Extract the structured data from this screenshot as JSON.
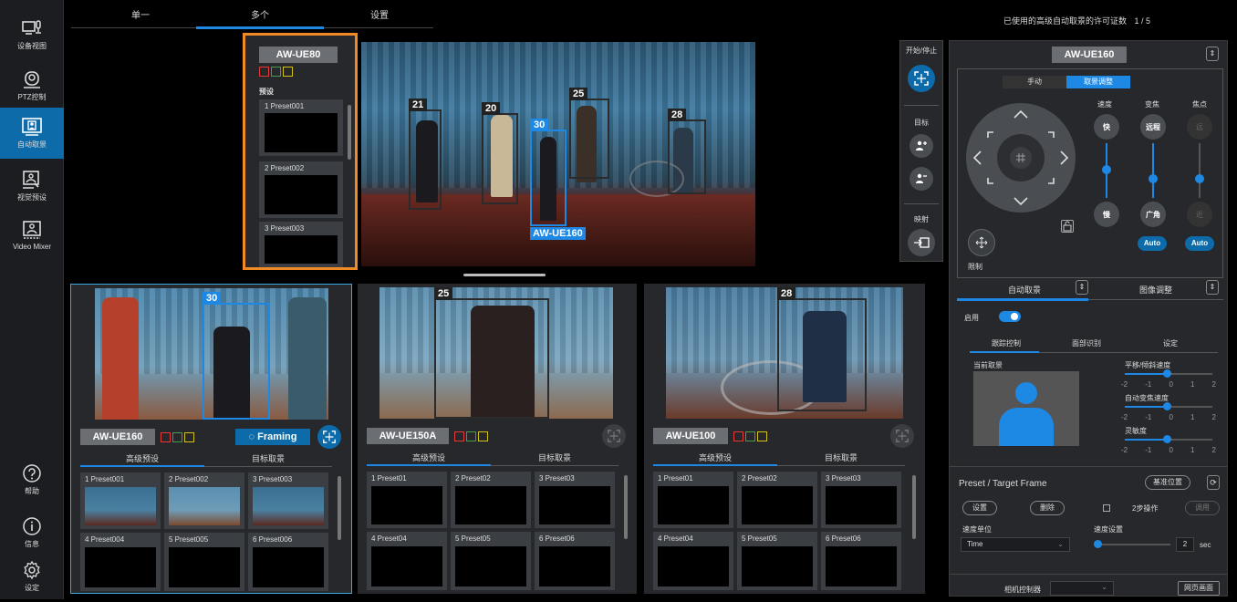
{
  "sidebar": {
    "items": [
      {
        "label": "设备视图",
        "icon": "device-view-icon"
      },
      {
        "label": "PTZ控制",
        "icon": "ptz-camera-icon"
      },
      {
        "label": "自动取景",
        "icon": "auto-framing-icon"
      },
      {
        "label": "视觉预设",
        "icon": "visual-preset-icon"
      },
      {
        "label": "Video Mixer",
        "icon": "video-mixer-icon"
      }
    ],
    "bottom": [
      {
        "label": "帮助",
        "icon": "help-icon"
      },
      {
        "label": "信息",
        "icon": "info-icon"
      },
      {
        "label": "设定",
        "icon": "settings-gear-icon"
      }
    ]
  },
  "tabs": [
    "单一",
    "多个",
    "设置"
  ],
  "license": {
    "label": "已使用的高级自动取景的许可证数",
    "value": "1 / 5"
  },
  "top_preset": {
    "camera": "AW-UE80",
    "section": "预设",
    "presets": [
      "1  Preset001",
      "2  Preset002",
      "3  Preset003"
    ]
  },
  "main_view": {
    "targets": [
      "21",
      "20",
      "30",
      "25",
      "28"
    ],
    "selected_caption": "AW-UE160"
  },
  "start_stop": {
    "label": "开始/停止",
    "target_label": "目标",
    "mapping_label": "映射"
  },
  "cameras": [
    {
      "name": "AW-UE160",
      "target": "30",
      "framing_label": "Framing",
      "tabs": [
        "高级预设",
        "目标取景"
      ],
      "presets": [
        "1  Preset001",
        "2  Preset002",
        "3  Preset003",
        "4  Preset004",
        "5  Preset005",
        "6  Preset006"
      ]
    },
    {
      "name": "AW-UE150A",
      "target": "25",
      "tabs": [
        "高级预设",
        "目标取景"
      ],
      "presets": [
        "1  Preset01",
        "2  Preset02",
        "3  Preset03",
        "4  Preset04",
        "5  Preset05",
        "6  Preset06"
      ]
    },
    {
      "name": "AW-UE100",
      "target": "28",
      "tabs": [
        "高级预设",
        "目标取景"
      ],
      "presets": [
        "1  Preset01",
        "2  Preset02",
        "3  Preset03",
        "4  Preset04",
        "5  Preset05",
        "6  Preset06"
      ]
    }
  ],
  "right_panel": {
    "camera": "AW-UE160",
    "mode_tabs": [
      "手动",
      "取景调整"
    ],
    "speed": {
      "label": "速度",
      "fast": "快",
      "slow": "慢"
    },
    "zoom": {
      "label": "变焦",
      "tele": "远程",
      "wide": "广角",
      "auto": "Auto"
    },
    "focus": {
      "label": "焦点",
      "near": "远",
      "far": "近",
      "auto": "Auto"
    },
    "limit_label": "限制",
    "section_tabs": [
      "自动取景",
      "图像调整"
    ],
    "enable_label": "启用",
    "enabled": true,
    "sub_tabs": [
      "跟踪控制",
      "面部识别",
      "设定"
    ],
    "current_framing": "当前取景",
    "sliders": [
      {
        "label": "平移/倾斜速度",
        "value": 0
      },
      {
        "label": "自动变焦速度",
        "value": 0
      },
      {
        "label": "灵敏度",
        "value": 0
      }
    ],
    "scale": [
      "-2",
      "-1",
      "0",
      "1",
      "2"
    ],
    "preset_section": {
      "title": "Preset / Target Frame",
      "base_position": "基准位置",
      "set": "设置",
      "delete": "删除",
      "two_step": "2步操作",
      "recall": "调用",
      "speed_unit_label": "速度单位",
      "speed_unit_value": "Time",
      "speed_setting_label": "速度设置",
      "speed_value": "2",
      "unit": "sec"
    },
    "footer": {
      "camera_controller": "相机控制器",
      "web_screen": "网页画面"
    }
  },
  "colors": {
    "accent": "#1e88e5",
    "highlight_border": "#f08a24",
    "red": "#e53935",
    "green": "#43a047",
    "yellow": "#d4c21a"
  }
}
